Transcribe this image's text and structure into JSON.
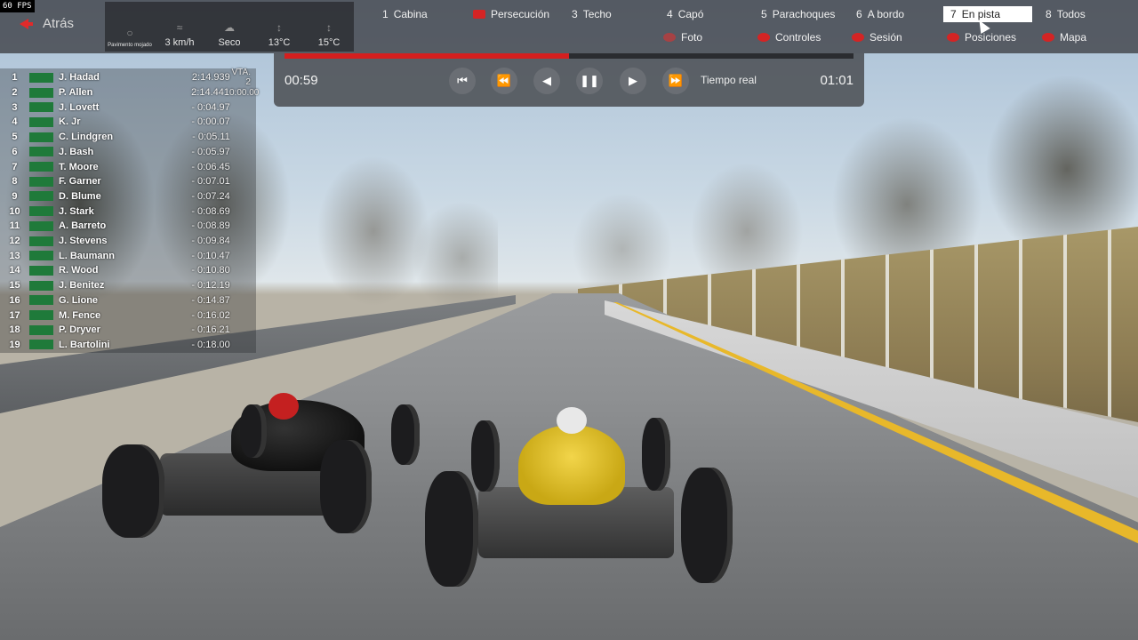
{
  "fps": "60 FPS",
  "back_label": "Atrás",
  "conditions": [
    {
      "icon": "steering-icon",
      "glyph": "○",
      "label": "Pavimento mojado",
      "small": true
    },
    {
      "icon": "wind-icon",
      "glyph": "≈",
      "label": "3 km/h"
    },
    {
      "icon": "weather-icon",
      "glyph": "☁",
      "label": "Seco"
    },
    {
      "icon": "thermometer-icon",
      "glyph": "↕",
      "label": "13°C"
    },
    {
      "icon": "track-temp-icon",
      "glyph": "↕",
      "label": "15°C"
    }
  ],
  "cameras": [
    {
      "key": "1",
      "label": "Cabina"
    },
    {
      "key": "",
      "label": "Persecución"
    },
    {
      "key": "3",
      "label": "Techo"
    },
    {
      "key": "4",
      "label": "Capó"
    },
    {
      "key": "5",
      "label": "Parachoques"
    },
    {
      "key": "6",
      "label": "A bordo"
    },
    {
      "key": "7",
      "label": "En pista"
    },
    {
      "key": "8",
      "label": "Todos"
    }
  ],
  "controls": [
    "Foto",
    "Controles",
    "Sesión",
    "Posiciones",
    "Mapa"
  ],
  "replay": {
    "current_time": "00:59",
    "total_time": "01:01",
    "mode": "Tiempo real",
    "progress": 0.5
  },
  "standings": [
    {
      "pos": "1",
      "name": "J. Hadad",
      "gap": "2:14.939",
      "lap": "VTA. 2"
    },
    {
      "pos": "2",
      "name": "P. Allen",
      "gap": "2:14.441",
      "lap": "0:00.00"
    },
    {
      "pos": "3",
      "name": "J. Lovett",
      "gap": "- 0:04.97",
      "lap": ""
    },
    {
      "pos": "4",
      "name": "K. Jr",
      "gap": "- 0:00.07",
      "lap": ""
    },
    {
      "pos": "5",
      "name": "C. Lindgren",
      "gap": "- 0:05.11",
      "lap": ""
    },
    {
      "pos": "6",
      "name": "J. Bash",
      "gap": "- 0:05.97",
      "lap": ""
    },
    {
      "pos": "7",
      "name": "T. Moore",
      "gap": "- 0:06.45",
      "lap": ""
    },
    {
      "pos": "8",
      "name": "F. Garner",
      "gap": "- 0:07.01",
      "lap": ""
    },
    {
      "pos": "9",
      "name": "D. Blume",
      "gap": "- 0:07.24",
      "lap": ""
    },
    {
      "pos": "10",
      "name": "J. Stark",
      "gap": "- 0:08.69",
      "lap": ""
    },
    {
      "pos": "11",
      "name": "A. Barreto",
      "gap": "- 0:08.89",
      "lap": ""
    },
    {
      "pos": "12",
      "name": "J. Stevens",
      "gap": "- 0:09.84",
      "lap": ""
    },
    {
      "pos": "13",
      "name": "L. Baumann",
      "gap": "- 0:10.47",
      "lap": ""
    },
    {
      "pos": "14",
      "name": "R. Wood",
      "gap": "- 0:10.80",
      "lap": ""
    },
    {
      "pos": "15",
      "name": "J. Benitez",
      "gap": "- 0:12.19",
      "lap": ""
    },
    {
      "pos": "16",
      "name": "G. Lione",
      "gap": "- 0:14.87",
      "lap": ""
    },
    {
      "pos": "17",
      "name": "M. Fence",
      "gap": "- 0:16.02",
      "lap": ""
    },
    {
      "pos": "18",
      "name": "P. Dryver",
      "gap": "- 0:16.21",
      "lap": ""
    },
    {
      "pos": "19",
      "name": "L. Bartolini",
      "gap": "- 0:18.00",
      "lap": ""
    }
  ],
  "colors": {
    "accent": "#d42424",
    "flag": "#1f7a3a",
    "car_yellow": "#e5c62e"
  }
}
